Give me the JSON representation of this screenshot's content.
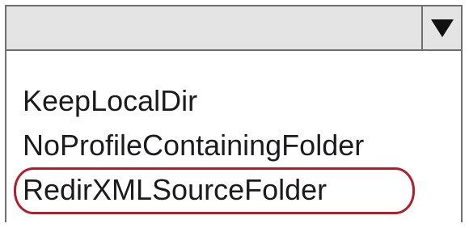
{
  "dropdown": {
    "selected_value": "",
    "toggle_icon": "dropdown-arrow-icon",
    "options": [
      {
        "label": "KeepLocalDir"
      },
      {
        "label": "NoProfileContainingFolder"
      },
      {
        "label": "RedirXMLSourceFolder",
        "highlighted": true
      }
    ]
  },
  "colors": {
    "combo_background": "#e4e4e4",
    "border": "#6f6f6f",
    "highlight_outline": "#b01e2a",
    "text": "#1b1b1b"
  }
}
